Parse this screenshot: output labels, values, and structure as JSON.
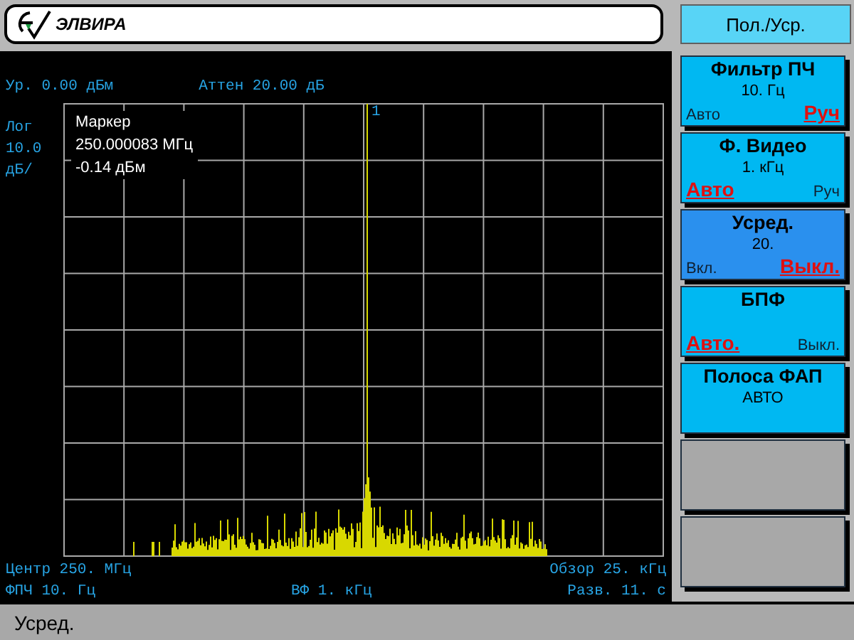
{
  "header": {
    "logo_text": "ЭЛВИРА"
  },
  "menu_title": "Пол./Уср.",
  "screen": {
    "reference_level": "Ур. 0.00 дБм",
    "attenuation": "Аттен 20.00 дБ",
    "scale_labels": [
      "Лог",
      "10.0",
      "дБ/"
    ],
    "marker": {
      "number": "1",
      "title": "Маркер",
      "frequency": "250.000083 МГц",
      "amplitude": "-0.14 дБм"
    },
    "center_frequency": "Центр 250. МГц",
    "span": "Обзор 25. кГц",
    "rbw": "ФПЧ 10. Гц",
    "vbw": "ВФ 1. кГц",
    "sweep_time": "Разв. 11. с"
  },
  "softkeys": [
    {
      "kind": "choice",
      "title": "Фильтр ПЧ",
      "value": "10. Гц",
      "active": false,
      "options": [
        {
          "label": "Авто",
          "selected": false
        },
        {
          "label": "Руч",
          "selected": true
        }
      ]
    },
    {
      "kind": "choice",
      "title": "Ф. Видео",
      "value": "1. кГц",
      "active": false,
      "options": [
        {
          "label": "Авто",
          "selected": true
        },
        {
          "label": "Руч",
          "selected": false
        }
      ]
    },
    {
      "kind": "choice",
      "title": "Усред.",
      "value": "20.",
      "active": true,
      "options": [
        {
          "label": "Вкл.",
          "selected": false
        },
        {
          "label": "Выкл.",
          "selected": true
        }
      ]
    },
    {
      "kind": "choice",
      "title": "БПФ",
      "active": false,
      "options": [
        {
          "label": "Авто.",
          "selected": true
        },
        {
          "label": "Выкл.",
          "selected": false
        }
      ]
    },
    {
      "kind": "value",
      "title": "Полоса ФАП",
      "value": "АВТО",
      "active": false
    },
    {
      "kind": "blank",
      "active": false
    },
    {
      "kind": "blank",
      "active": false
    }
  ],
  "status_bar": "Усред."
}
